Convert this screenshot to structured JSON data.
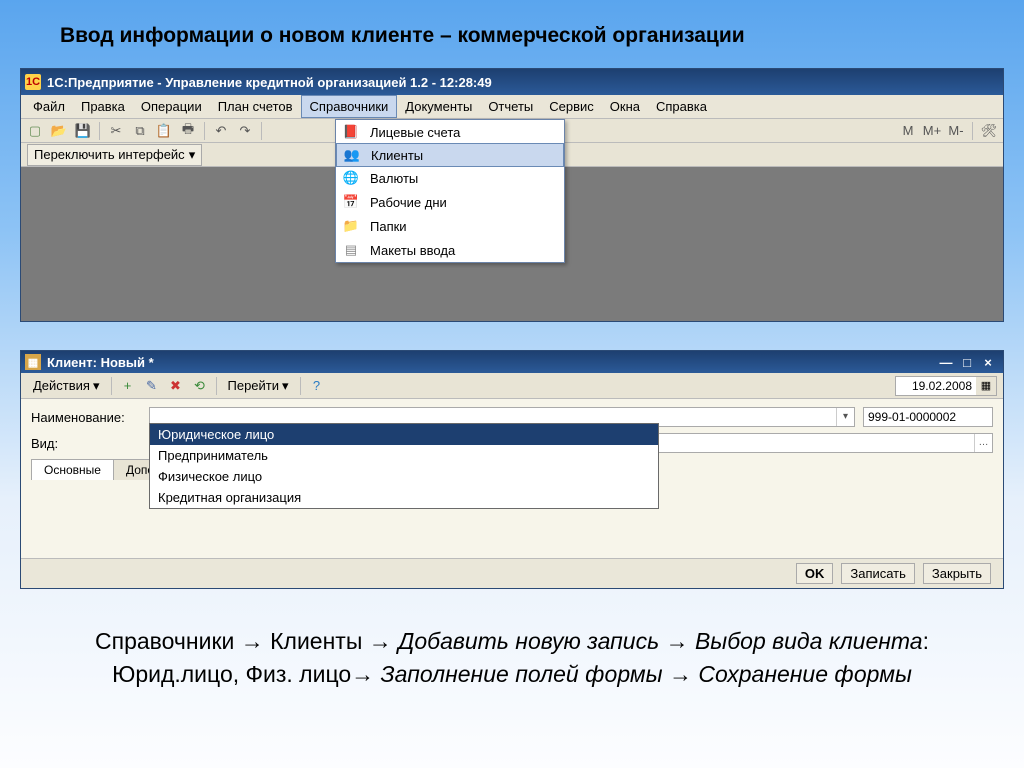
{
  "slide_title": "Ввод информации о новом клиенте – коммерческой организации",
  "win1": {
    "title": "1С:Предприятие - Управление кредитной организацией 1.2 - 12:28:49",
    "menu": [
      "Файл",
      "Правка",
      "Операции",
      "План счетов",
      "Справочники",
      "Документы",
      "Отчеты",
      "Сервис",
      "Окна",
      "Справка"
    ],
    "switch_ui": "Переключить интерфейс",
    "dropdown": {
      "items": [
        "Лицевые счета",
        "Клиенты",
        "Валюты",
        "Рабочие дни",
        "Папки",
        "Макеты ввода"
      ],
      "icons": [
        "book-icon",
        "people-icon",
        "globe-icon",
        "calendar-icon",
        "folder-icon",
        "layout-icon"
      ],
      "selected_index": 1
    }
  },
  "win2": {
    "title": "Клиент: Новый *",
    "actions": "Действия",
    "jump": "Перейти",
    "date": "19.02.2008",
    "name_label": "Наименование:",
    "code": "999-01-0000002",
    "vid_label": "Вид:",
    "tabs": [
      "Основные",
      "Дополн"
    ],
    "vid_options": [
      "Юридическое лицо",
      "Предприниматель",
      "Физическое лицо",
      "Кредитная организация"
    ],
    "vid_selected": 0,
    "btn_ok": "OK",
    "btn_save": "Записать",
    "btn_close": "Закрыть"
  },
  "caption": {
    "p1a": "Справочники → Клиенты → ",
    "p1b": "Добавить новую запись → Выбор вида клиента",
    "p2a": ": Юрид.лицо, Физ. лицо",
    "p2b": "→ Заполнение полей формы → Сохранение формы"
  },
  "glyph": {
    "tri": "▾",
    "dots": "…",
    "help": "?",
    "min": "—",
    "max": "□",
    "close": "×"
  }
}
